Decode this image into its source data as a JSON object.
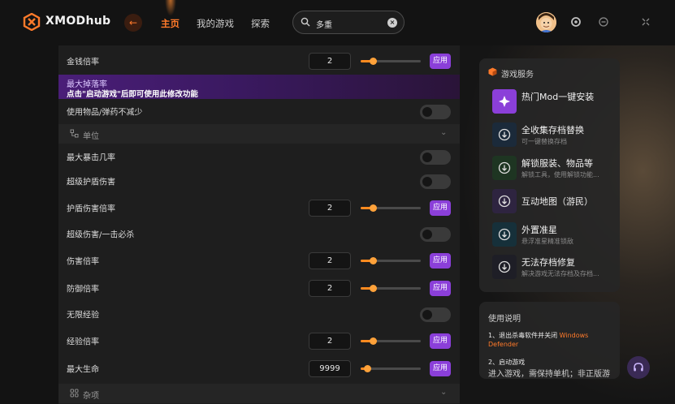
{
  "app": {
    "name": "XMODhub"
  },
  "nav": {
    "home": "主页",
    "my_games": "我的游戏",
    "explore": "探索"
  },
  "search": {
    "value": "多重"
  },
  "colors": {
    "accent": "#ff7a2a",
    "apply": "#8b3fd9",
    "slider": "#ff8a1f"
  },
  "settings": {
    "money_rate": {
      "label": "金钱倍率",
      "value": "2",
      "level": 0.1,
      "apply": "应用"
    },
    "banner": {
      "title": "最大掉落率",
      "notice": "点击\"启动游戏\"后即可使用此修改功能"
    },
    "use_items": {
      "label": "使用物品/弹药不减少"
    },
    "section_unit": {
      "label": "单位"
    },
    "max_crit": {
      "label": "最大暴击几率"
    },
    "super_shield": {
      "label": "超级护盾伤害"
    },
    "shield_damage_rate": {
      "label": "护盾伤害倍率",
      "value": "2",
      "level": 0.1,
      "apply": "应用"
    },
    "super_damage": {
      "label": "超级伤害/一击必杀"
    },
    "damage_rate": {
      "label": "伤害倍率",
      "value": "2",
      "level": 0.1,
      "apply": "应用"
    },
    "defense_rate": {
      "label": "防御倍率",
      "value": "2",
      "level": 0.1,
      "apply": "应用"
    },
    "infinite_xp": {
      "label": "无限经验"
    },
    "xp_rate": {
      "label": "经验倍率",
      "value": "2",
      "level": 0.1,
      "apply": "应用"
    },
    "max_health": {
      "label": "最大生命",
      "value": "9999",
      "level": 0.0,
      "apply": "应用"
    },
    "section_misc": {
      "label": "杂项"
    }
  },
  "services": {
    "title": "游戏服务",
    "items": [
      {
        "title": "热门Mod一键安装",
        "subtitle": "",
        "icon": "mod-install-icon"
      },
      {
        "title": "全收集存档替换",
        "subtitle": "可一键替换存档",
        "icon": "download-icon"
      },
      {
        "title": "解锁服装、物品等",
        "subtitle": "解锁工具，使用解锁功能...",
        "icon": "download-icon"
      },
      {
        "title": "互动地图（游民）",
        "subtitle": "",
        "icon": "download-icon"
      },
      {
        "title": "外置准星",
        "subtitle": "悬浮准星精准锁敌",
        "icon": "download-icon"
      },
      {
        "title": "无法存档修复",
        "subtitle": "解决游戏无法存档及存档...",
        "icon": "download-icon"
      }
    ]
  },
  "help": {
    "title": "使用说明",
    "step1_a": "1、退出杀毒软件并关闭",
    "step1_b": "Windows",
    "step1_c": "Defender",
    "step2_title": "2、启动游戏",
    "step2_body": "进入游戏，需保持单机；非正版游"
  }
}
